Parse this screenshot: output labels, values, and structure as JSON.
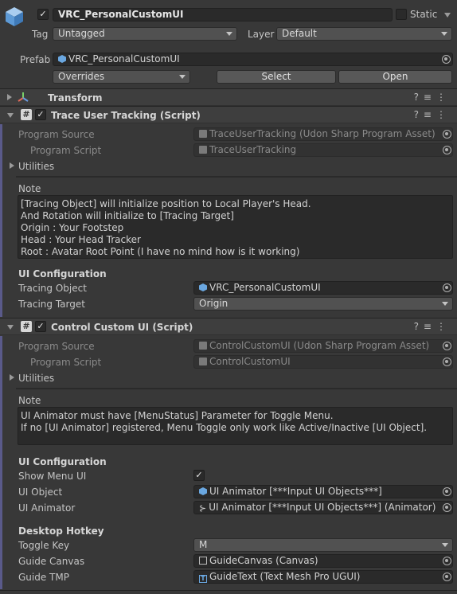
{
  "header": {
    "object_name": "VRC_PersonalCustomUI",
    "static_label": "Static",
    "tag_label": "Tag",
    "tag_value": "Untagged",
    "layer_label": "Layer",
    "layer_value": "Default",
    "prefab_label": "Prefab",
    "prefab_value": "VRC_PersonalCustomUI",
    "overrides_label": "Overrides",
    "select_label": "Select",
    "open_label": "Open"
  },
  "transform": {
    "title": "Transform"
  },
  "trace": {
    "title": "Trace User Tracking (Script)",
    "program_source_label": "Program Source",
    "program_source_value": "TraceUserTracking (Udon Sharp Program Asset)",
    "program_script_label": "Program Script",
    "program_script_value": "TraceUserTracking",
    "utilities_label": "Utilities",
    "note_label": "Note",
    "note_text": "[Tracing Object] will initialize position to Local Player's Head.\nAnd Rotation will initialize to [Tracing Target]\nOrigin : Your Footstep\nHead : Your Head Tracker\nRoot : Avatar Root Point (I have no mind how is it working)",
    "ui_config_label": "UI Configuration",
    "tracing_object_label": "Tracing Object",
    "tracing_object_value": "VRC_PersonalCustomUI",
    "tracing_target_label": "Tracing Target",
    "tracing_target_value": "Origin"
  },
  "control": {
    "title": "Control Custom UI (Script)",
    "program_source_label": "Program Source",
    "program_source_value": "ControlCustomUI (Udon Sharp Program Asset)",
    "program_script_label": "Program Script",
    "program_script_value": "ControlCustomUI",
    "utilities_label": "Utilities",
    "note_label": "Note",
    "note_text": "UI Animator must have [MenuStatus] Parameter for Toggle Menu.\nIf no [UI Animator] registered, Menu Toggle only work like Active/Inactive [UI Object].",
    "ui_config_label": "UI Configuration",
    "show_menu_label": "Show Menu UI",
    "ui_object_label": "UI Object",
    "ui_object_value": "UI Animator [***Input UI Objects***]",
    "ui_animator_label": "UI Animator",
    "ui_animator_value": "UI Animator [***Input UI Objects***] (Animator)",
    "desktop_hotkey_label": "Desktop Hotkey",
    "toggle_key_label": "Toggle Key",
    "toggle_key_value": "M",
    "guide_canvas_label": "Guide Canvas",
    "guide_canvas_value": "GuideCanvas (Canvas)",
    "guide_tmp_label": "Guide TMP",
    "guide_tmp_value": "GuideText (Text Mesh Pro UGUI)"
  },
  "glyphs": {
    "check": "✓",
    "hash": "#",
    "tmp": "T",
    "anim": "⊱"
  },
  "colors": {
    "background": "#383838",
    "field": "#2a2a2a",
    "header": "#3e3e3e",
    "accent_icon": "#6aa7e0"
  }
}
